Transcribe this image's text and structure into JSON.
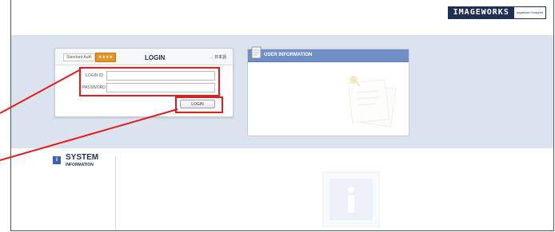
{
  "header": {
    "brand_name": "IMAGEWORKS",
    "brand_tagline": "organized footprint"
  },
  "login": {
    "standard_label": "Standard Auth",
    "badge_label": "★★★★",
    "title": "LOGIN",
    "language_link": "→ 日本語",
    "login_id_label": "LOGIN ID",
    "password_label": "PASSWORD",
    "login_id_value": "",
    "password_value": "",
    "login_button": "LOGIN"
  },
  "user_info": {
    "title": "USER INFORMATION"
  },
  "system_info": {
    "title": "SYSTEM",
    "subtitle": "INFORMATION",
    "icon_glyph": "i"
  },
  "colors": {
    "highlight": "#e61b1b",
    "band": "#dbe3ef",
    "panel_header": "#6f8fc6",
    "brand": "#1e2f53",
    "badge": "#e39526"
  }
}
